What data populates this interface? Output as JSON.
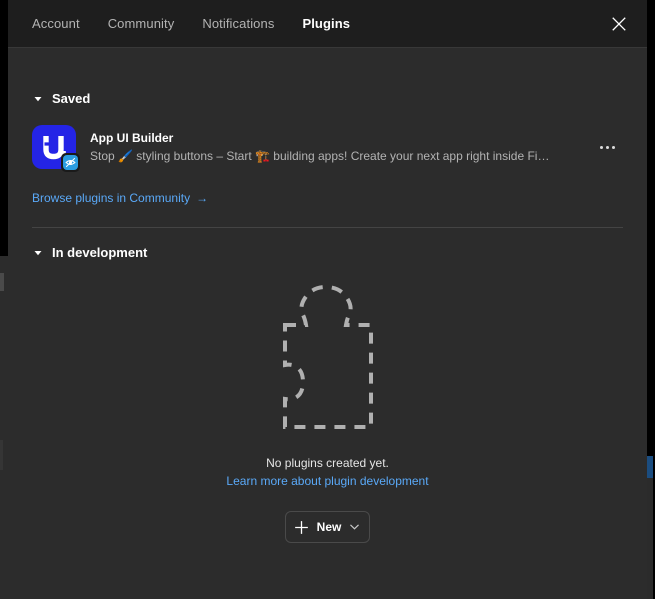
{
  "window": {
    "background_color": "#2c2c2c",
    "tabbar_color": "#1e1e1e"
  },
  "tabs": {
    "items": [
      {
        "label": "Account",
        "active": false
      },
      {
        "label": "Community",
        "active": false
      },
      {
        "label": "Notifications",
        "active": false
      },
      {
        "label": "Plugins",
        "active": true
      }
    ],
    "close_icon": "close-icon"
  },
  "saved": {
    "title": "Saved",
    "caret_icon": "caret-down-icon",
    "plugin": {
      "name": "App UI Builder",
      "description": "Stop 🖌️ styling buttons – Start 🏗️ building apps! Create your next app right inside Fig...",
      "icon_name": "app-ui-builder-icon",
      "icon_color": "#2424e6",
      "badge_color": "#2b9de0",
      "more_icon": "more-horizontal-icon"
    },
    "browse_link": {
      "label": "Browse plugins in Community",
      "arrow": "→",
      "color": "#5aa9f8"
    }
  },
  "in_development": {
    "title": "In development",
    "caret_icon": "caret-down-icon",
    "empty_state": {
      "illustration": "puzzle-piece-dashed-icon",
      "title": "No plugins created yet.",
      "link_label": "Learn more about plugin development",
      "link_color": "#5aa9f8"
    },
    "new_button": {
      "label": "New",
      "plus_icon": "plus-icon",
      "chevron_icon": "chevron-down-icon"
    }
  }
}
